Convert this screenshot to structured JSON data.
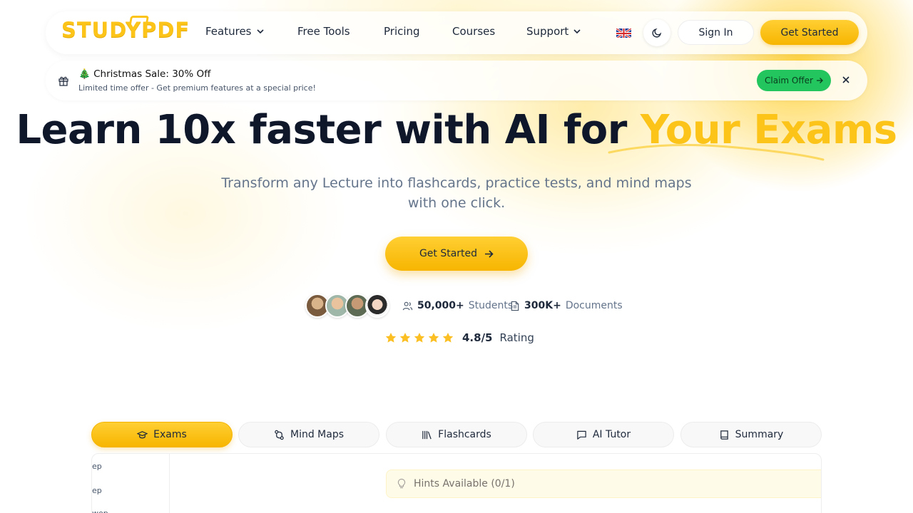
{
  "brand": {
    "logo_text": "STUDYPDF",
    "accent": "#fcc419",
    "success": "#22c55e"
  },
  "nav": {
    "links": [
      {
        "label": "Features",
        "has_menu": true
      },
      {
        "label": "Free Tools",
        "has_menu": false
      },
      {
        "label": "Pricing",
        "has_menu": false
      },
      {
        "label": "Courses",
        "has_menu": false
      },
      {
        "label": "Support",
        "has_menu": true
      }
    ],
    "language_icon": "uk-flag-icon",
    "theme_icon": "moon-icon",
    "sign_in": "Sign In",
    "get_started": "Get Started"
  },
  "promo": {
    "emoji": "🎄",
    "title": "Christmas Sale: 30% Off",
    "subtitle": "Limited time offer - Get premium features at a special price!",
    "claim": "Claim Offer",
    "icon": "gift-icon"
  },
  "hero": {
    "title_main": "Learn 10x faster with AI for ",
    "title_accent": "Your Exams",
    "subtitle": "Transform any Lecture into flashcards, practice tests, and mind maps with one click.",
    "cta": "Get Started"
  },
  "stats": {
    "students_count": "50,000+",
    "students_label": "Students",
    "documents_count": "300K+",
    "documents_label": "Documents",
    "rating_value": "4.8/5",
    "rating_label": "Rating",
    "stars": 5
  },
  "tabs": [
    {
      "label": "Exams",
      "icon": "graduation-cap-icon",
      "active": true
    },
    {
      "label": "Mind Maps",
      "icon": "route-icon",
      "active": false
    },
    {
      "label": "Flashcards",
      "icon": "library-icon",
      "active": false
    },
    {
      "label": "AI Tutor",
      "icon": "message-icon",
      "active": false
    },
    {
      "label": "Summary",
      "icon": "book-icon",
      "active": false
    }
  ],
  "preview": {
    "side_items": [
      "ep",
      "ep",
      "wep"
    ],
    "hints": "Hints Available (0/1)"
  }
}
